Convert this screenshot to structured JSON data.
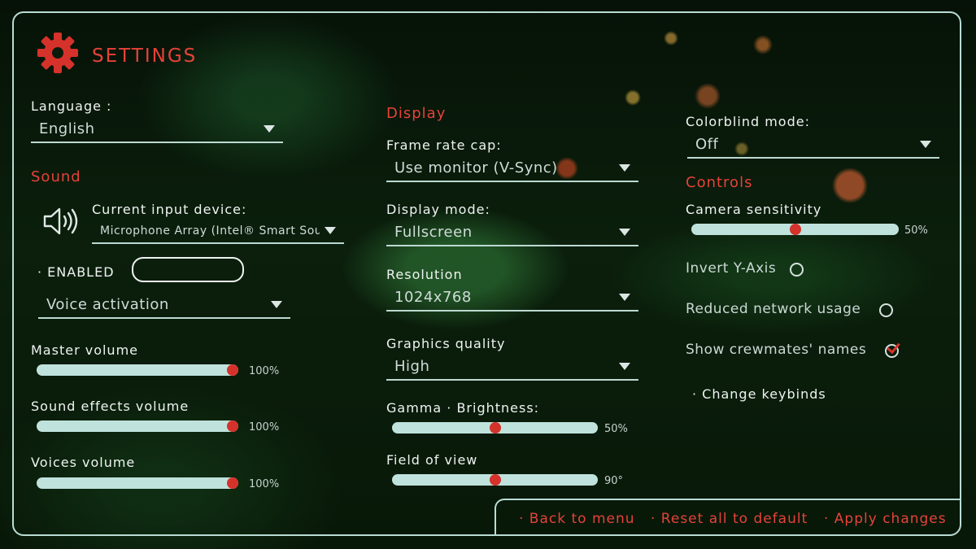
{
  "header": {
    "title": "SETTINGS",
    "icon": "gear-icon",
    "accent": "#e6423a"
  },
  "language": {
    "label": "Language :",
    "value": "English"
  },
  "sound": {
    "heading": "Sound",
    "input_device_label": "Current input device:",
    "input_device_value": "Microphone Array (Intel® Smart Sou",
    "enabled_label": "· ENABLED",
    "voice_mode": "Voice activation",
    "sliders": [
      {
        "label": "Master volume",
        "value": 100,
        "text": "100%"
      },
      {
        "label": "Sound effects volume",
        "value": 100,
        "text": "100%"
      },
      {
        "label": "Voices volume",
        "value": 100,
        "text": "100%"
      }
    ]
  },
  "display": {
    "heading": "Display",
    "frame_rate_label": "Frame rate cap:",
    "frame_rate_value": "Use monitor (V-Sync)",
    "display_mode_label": "Display mode:",
    "display_mode_value": "Fullscreen",
    "resolution_label": "Resolution",
    "resolution_value": "1024x768",
    "graphics_label": "Graphics quality",
    "graphics_value": "High",
    "gamma_label": "Gamma · Brightness:",
    "gamma_value": 50,
    "gamma_text": "50%",
    "fov_label": "Field of view",
    "fov_value": 50,
    "fov_text": "90°"
  },
  "colorblind": {
    "label": "Colorblind mode:",
    "value": "Off"
  },
  "controls": {
    "heading": "Controls",
    "camera_label": "Camera sensitivity",
    "camera_value": 50,
    "camera_text": "50%",
    "invert_label": "Invert Y-Axis",
    "invert_checked": false,
    "network_label": "Reduced network usage",
    "network_checked": false,
    "names_label": "Show crewmates' names",
    "names_checked": true,
    "keybinds_label": "· Change keybinds"
  },
  "actions": {
    "back": "· Back to menu",
    "reset": "· Reset all to default",
    "apply": "· Apply changes"
  }
}
